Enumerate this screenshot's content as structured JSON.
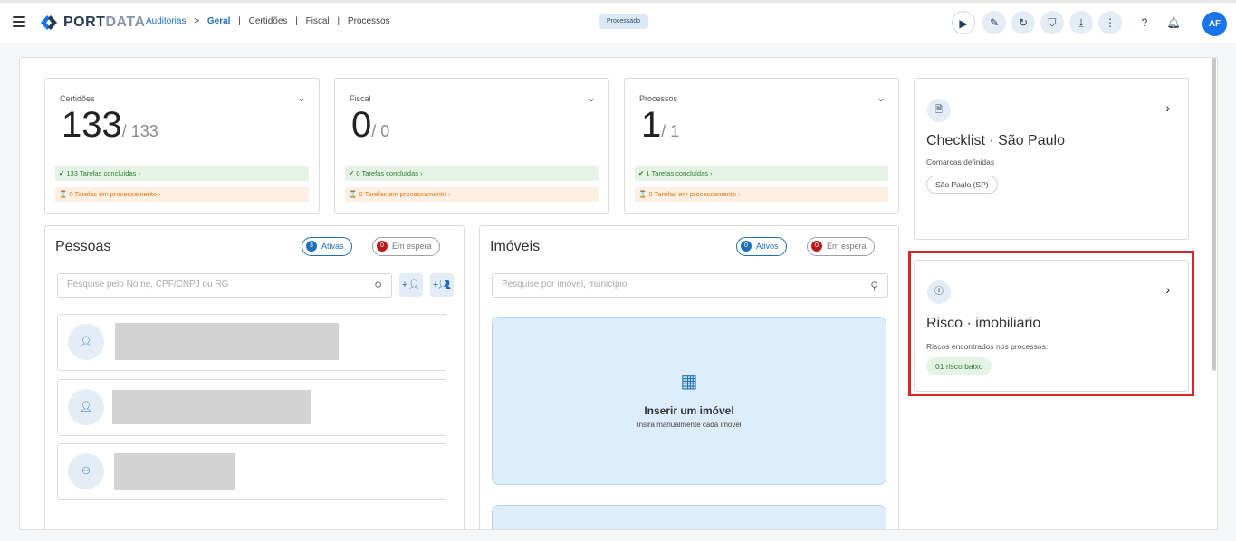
{
  "header": {
    "logo_text_a": "PORT",
    "logo_text_b": "DATA",
    "breadcrumb": {
      "root": "Auditorias",
      "arrow": ">",
      "current": "Geral",
      "items": [
        "Certidões",
        "Fiscal",
        "Processos"
      ],
      "separator": "|"
    },
    "status": "Processado",
    "icons": [
      "play-icon",
      "edit-icon",
      "refresh-icon",
      "shield-check-icon",
      "download-icon",
      "more-vertical-icon",
      "help-icon",
      "bell-icon"
    ],
    "avatar": "AF"
  },
  "stats": [
    {
      "label": "Certidões",
      "value": "133",
      "total": "/ 133",
      "done": "133 Tarefas concluídas",
      "processing": "0 Tarefas em processamento"
    },
    {
      "label": "Fiscal",
      "value": "0",
      "total": "/ 0",
      "done": "0 Tarefas concluídas",
      "processing": "0 Tarefas em processamento"
    },
    {
      "label": "Processos",
      "value": "1",
      "total": "/ 1",
      "done": "1 Tarefas concluídas",
      "processing": "0 Tarefas em processamento"
    }
  ],
  "pessoas": {
    "title": "Pessoas",
    "active_count": "3",
    "active_label": "Ativas",
    "waiting_count": "0",
    "waiting_label": "Em espera",
    "search_placeholder": "Pesquise pelo Nome, CPF/CNPJ ou RG"
  },
  "imoveis": {
    "title": "Imóveis",
    "active_count": "0",
    "active_label": "Ativos",
    "waiting_count": "0",
    "waiting_label": "Em espera",
    "search_placeholder": "Pesquise por imóvel, município",
    "insert_title": "Inserir um imóvel",
    "insert_subtitle": "Insira manualmente cada imóvel"
  },
  "checklist": {
    "title": "Checklist · São Paulo",
    "subtitle": "Comarcas definidas",
    "chip": "São Paulo (SP)"
  },
  "risco": {
    "title": "Risco · imobiliario",
    "subtitle": "Riscos encontrados nos processos:",
    "chip": "01 risco baixo"
  },
  "colors": {
    "accent": "#1f6fb8",
    "highlight": "#d9262a",
    "success": "#2e7d32",
    "warning": "#e07a1a"
  }
}
